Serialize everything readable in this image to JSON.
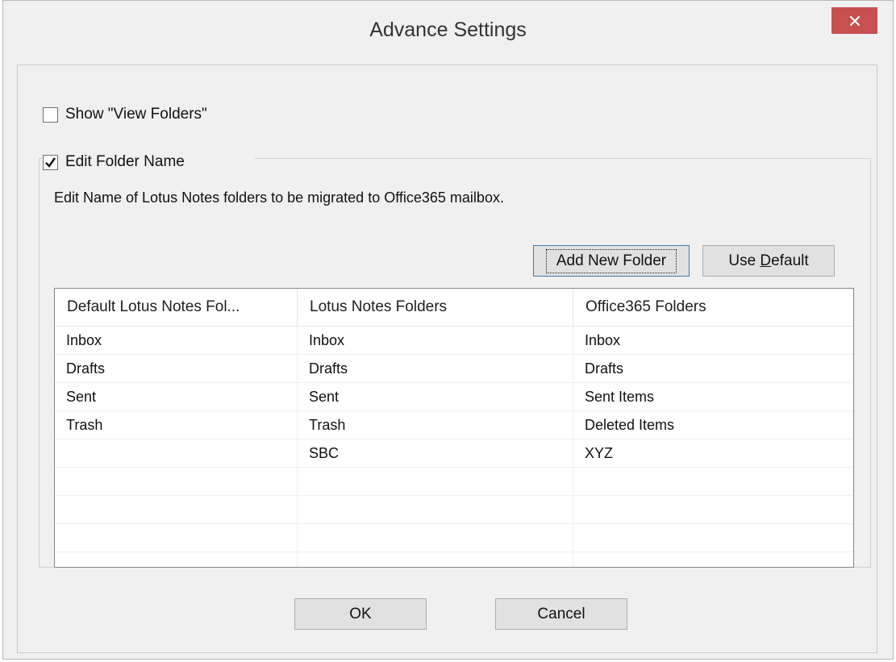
{
  "window": {
    "title": "Advance Settings"
  },
  "options": {
    "show_view_folders": {
      "label": "Show \"View Folders\"",
      "checked": false
    },
    "edit_folder_name": {
      "label": "Edit Folder Name",
      "checked": true
    }
  },
  "group": {
    "description": "Edit Name of Lotus Notes folders to be migrated to Office365 mailbox."
  },
  "toolbar": {
    "add_new_folder_label": "Add New Folder",
    "use_default_prefix": "Use ",
    "use_default_mnemonic": "D",
    "use_default_suffix": "efault"
  },
  "table": {
    "columns": [
      "Default Lotus Notes Fol...",
      "Lotus Notes Folders",
      "Office365 Folders"
    ],
    "rows": [
      [
        "Inbox",
        "Inbox",
        "Inbox"
      ],
      [
        "Drafts",
        "Drafts",
        "Drafts"
      ],
      [
        "Sent",
        "Sent",
        "Sent Items"
      ],
      [
        "Trash",
        "Trash",
        "Deleted Items"
      ],
      [
        "",
        "SBC",
        "XYZ"
      ],
      [
        "",
        "",
        ""
      ],
      [
        "",
        "",
        ""
      ],
      [
        "",
        "",
        ""
      ],
      [
        "",
        "",
        ""
      ]
    ]
  },
  "footer": {
    "ok_label": "OK",
    "cancel_label": "Cancel"
  }
}
